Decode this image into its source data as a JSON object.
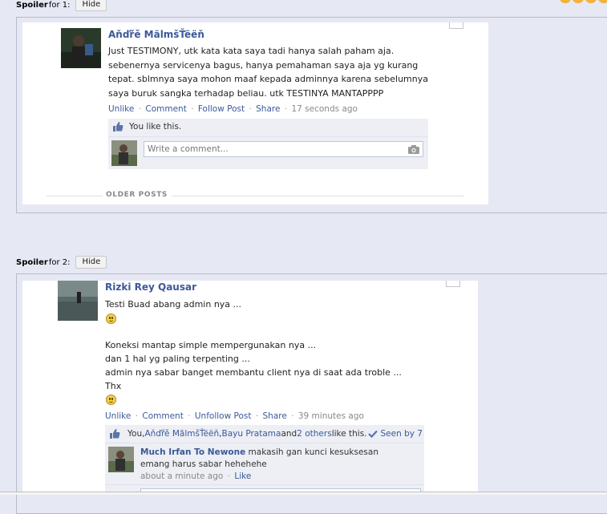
{
  "spoiler1": {
    "title": "Spoiler",
    "for_text": "for 1:",
    "button": "Hide"
  },
  "spoiler2": {
    "title": "Spoiler",
    "for_text": "for 2:",
    "button": "Hide"
  },
  "post1": {
    "author": "Aňďřě MãlmšŤëëň",
    "text": "Just TESTIMONY, utk kata kata saya tadi hanya salah paham aja. sebenernya servicenya bagus, hanya pemahaman saya aja yg kurang tepat. sblmnya saya mohon maaf kepada adminnya karena sebelumnya saya buruk sangka terhadap beliau. utk TESTINYA MANTAPPPP",
    "actions": {
      "unlike": "Unlike",
      "comment": "Comment",
      "follow": "Follow Post",
      "share": "Share",
      "time": "17 seconds ago",
      "sep": "·"
    },
    "likes_text": "You like this.",
    "comment_placeholder": "Write a comment...",
    "older_posts": "OLDER POSTS"
  },
  "post2": {
    "author": "Rizki Rey Qausar",
    "line1": "Testi Buad abang admin nya ...",
    "line2": "Koneksi mantap simple mempergunakan nya ...",
    "line3": "dan 1 hal yg paling terpenting ...",
    "line4": "admin nya sabar banget membantu client nya di saat ada troble ...",
    "line5": "Thx",
    "actions": {
      "unlike": "Unlike",
      "comment": "Comment",
      "unfollow": "Unfollow Post",
      "share": "Share",
      "time": "39 minutes ago",
      "sep": "·"
    },
    "likes": {
      "you": "You, ",
      "name1": "Aňďřě MãlmšŤëëň",
      "comma": ", ",
      "name2": "Bayu Pratama",
      "and": " and ",
      "others": "2 others",
      "suffix": " like this.",
      "seen": "Seen by 7"
    },
    "comment": {
      "author": "Much Irfan To Newone",
      "text": " makasih gan kunci kesuksesan emang harus sabar hehehehe",
      "time": "about a minute ago",
      "sep": "·",
      "like": "Like"
    }
  }
}
